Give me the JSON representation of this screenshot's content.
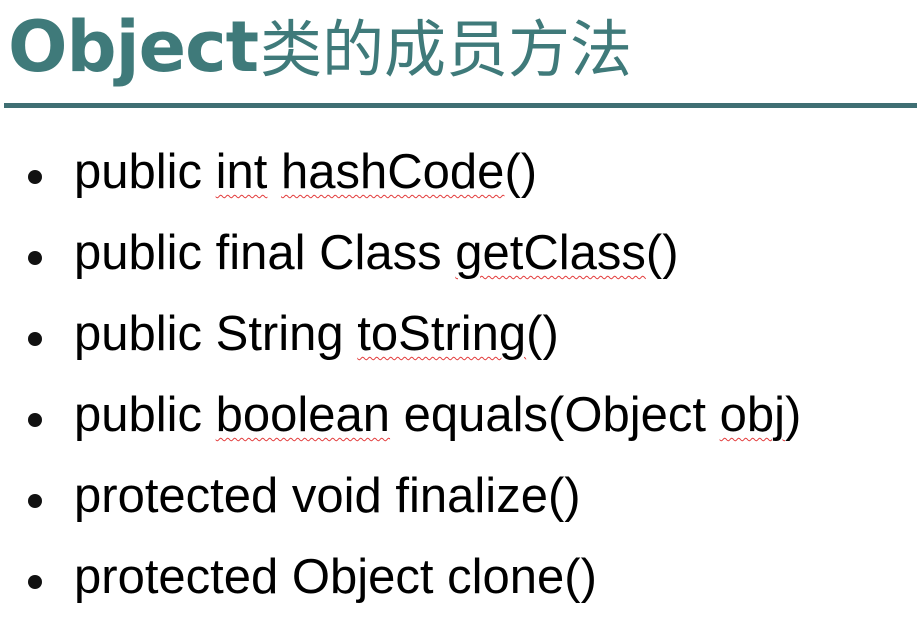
{
  "slide": {
    "title_en": "Object",
    "title_zh": "类的成员方法",
    "colors": {
      "title": "#3f7a7a",
      "rule": "#3f6f73",
      "text": "#000000",
      "spellcheck": "#e23b3b"
    },
    "items": [
      {
        "parts": [
          {
            "t": "public ",
            "sq": false
          },
          {
            "t": "int",
            "sq": true
          },
          {
            "t": " ",
            "sq": false
          },
          {
            "t": "hashCode",
            "sq": true
          },
          {
            "t": "()",
            "sq": false
          }
        ]
      },
      {
        "parts": [
          {
            "t": "public final Class ",
            "sq": false
          },
          {
            "t": "getClass",
            "sq": true
          },
          {
            "t": "()",
            "sq": false
          }
        ]
      },
      {
        "parts": [
          {
            "t": "public String ",
            "sq": false
          },
          {
            "t": "toString",
            "sq": true
          },
          {
            "t": "()",
            "sq": false
          }
        ]
      },
      {
        "parts": [
          {
            "t": "public ",
            "sq": false
          },
          {
            "t": "boolean",
            "sq": true
          },
          {
            "t": " equals(Object ",
            "sq": false
          },
          {
            "t": "obj",
            "sq": true
          },
          {
            "t": ")",
            "sq": false
          }
        ]
      },
      {
        "parts": [
          {
            "t": "protected void finalize()",
            "sq": false
          }
        ]
      },
      {
        "parts": [
          {
            "t": "protected Object clone()",
            "sq": false
          }
        ]
      }
    ]
  }
}
